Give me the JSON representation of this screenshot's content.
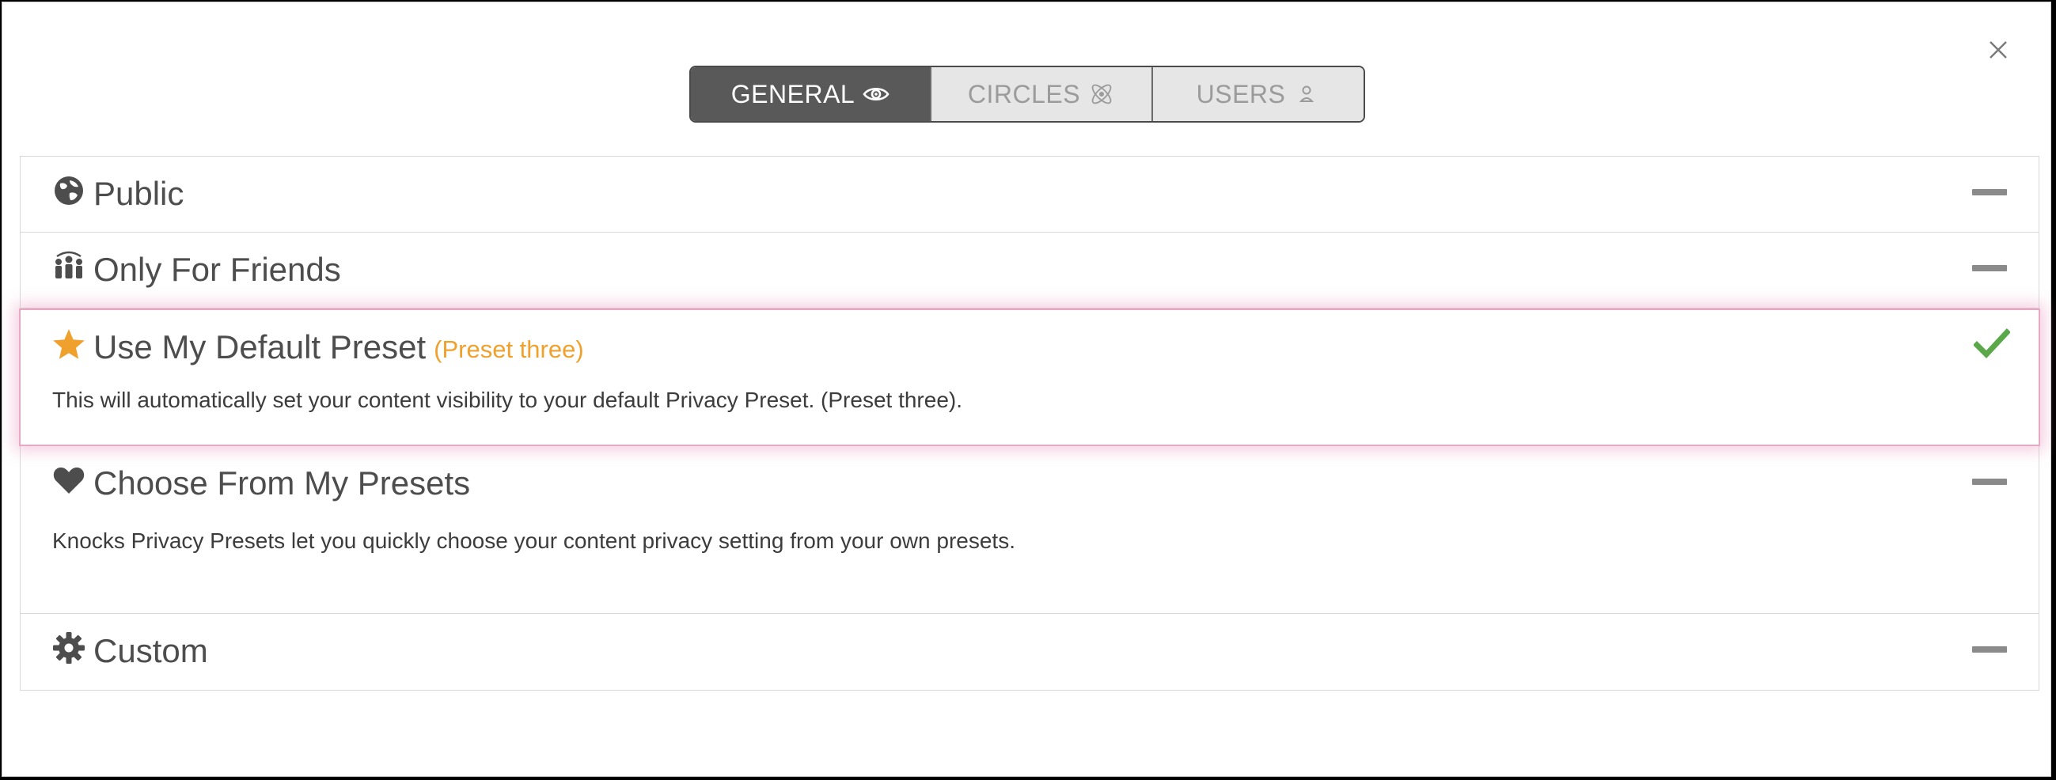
{
  "tabs": [
    {
      "label": "GENERAL",
      "icon": "eye-icon",
      "active": true
    },
    {
      "label": "CIRCLES",
      "icon": "atom-icon",
      "active": false
    },
    {
      "label": "USERS",
      "icon": "user-icon",
      "active": false
    }
  ],
  "options": {
    "public": {
      "title": "Public",
      "icon": "globe-icon"
    },
    "friends": {
      "title": "Only For Friends",
      "icon": "people-icon"
    },
    "default_preset": {
      "title": "Use My Default Preset",
      "subtitle": "(Preset three)",
      "icon": "star-icon",
      "description": "This will automatically set your content visibility to your default Privacy Preset. (Preset three)."
    },
    "choose_presets": {
      "title": "Choose From My Presets",
      "icon": "heart-icon",
      "description": "Knocks Privacy Presets let you quickly choose your content privacy setting from your own presets."
    },
    "custom": {
      "title": "Custom",
      "icon": "gear-icon"
    }
  },
  "colors": {
    "accent": "#f0a02c",
    "check": "#5aa84a",
    "tab_active_bg": "#595959",
    "tab_inactive_bg": "#e6e6e6",
    "highlight_glow": "#e8a8c4"
  }
}
